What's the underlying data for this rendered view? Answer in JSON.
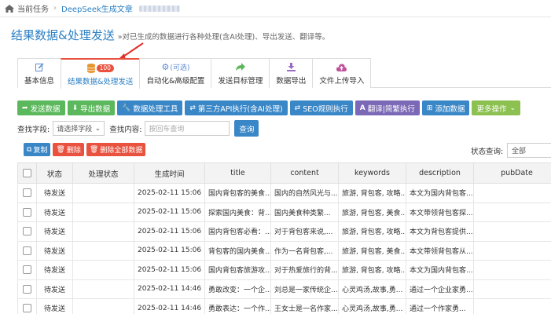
{
  "breadcrumb": {
    "home": "当前任务",
    "current": "DeepSeek生成文章"
  },
  "header": {
    "title": "结果数据&处理发送",
    "subtitle": "»对已生成的数据进行各种处理(含AI处理)、导出发送、翻译等。"
  },
  "tabs": [
    {
      "label": "基本信息",
      "icon": "edit-icon",
      "extra": ""
    },
    {
      "label": "结果数据&处理发送",
      "icon": "database-icon",
      "extra": "100"
    },
    {
      "label": "自动化&高级配置",
      "icon": "gears-icon",
      "extra": "(可选)"
    },
    {
      "label": "发送目标管理",
      "icon": "share-icon",
      "extra": ""
    },
    {
      "label": "数据导出",
      "icon": "download-icon",
      "extra": ""
    },
    {
      "label": "文件上传导入",
      "icon": "cloud-upload-icon",
      "extra": ""
    }
  ],
  "toolbar": [
    {
      "label": "发送数据",
      "color": "#5cb85c",
      "icon": "send-icon"
    },
    {
      "label": "导出数据",
      "color": "#5cb85c",
      "icon": "download-icon"
    },
    {
      "label": "数据处理工具",
      "color": "#3a87c8",
      "icon": "wrench-icon"
    },
    {
      "label": "第三方API执行(含AI处理)",
      "color": "#3a87c8",
      "icon": "exchange-icon"
    },
    {
      "label": "SEO规则执行",
      "color": "#3a87c8",
      "icon": "exchange-icon"
    },
    {
      "label": "翻译|简繁执行",
      "color": "#7b68b6",
      "icon": "font-icon"
    },
    {
      "label": "添加数据",
      "color": "#3a87c8",
      "icon": "plus-icon"
    },
    {
      "label": "更多操作",
      "color": "#8cc152",
      "icon": "chevron-down-icon"
    }
  ],
  "filter": {
    "field_label": "查找字段:",
    "field_placeholder": "请选择字段",
    "content_label": "查找内容:",
    "content_placeholder": "按回车查询",
    "query_label": "查询"
  },
  "actions": {
    "copy": "复制",
    "delete": "删除",
    "delete_all": "删除全部数据"
  },
  "status_query": {
    "label": "状态查询:",
    "value": "全部"
  },
  "table": {
    "columns": [
      "状态",
      "处理状态",
      "生成时间",
      "title",
      "content",
      "keywords",
      "description",
      "pubDate"
    ],
    "rows": [
      [
        "待发送",
        "",
        "2025-02-11 15:06",
        "国内背包客的美食...",
        "国内的自然风光与...",
        "旅游, 背包客, 攻略...",
        "本文为国内背包客...",
        ""
      ],
      [
        "待发送",
        "",
        "2025-02-11 15:06",
        "探索国内美食：背...",
        "国内美食种类繁...",
        "旅游, 背包客, 美食...",
        "本文带领背包客探...",
        ""
      ],
      [
        "待发送",
        "",
        "2025-02-11 15:06",
        "国内背包客必看：...",
        "对于背包客来说,...",
        "旅游, 背包客, 攻略...",
        "本文为背包客提供...",
        ""
      ],
      [
        "待发送",
        "",
        "2025-02-11 15:06",
        "背包客的国内美食...",
        "作为一名背包客,...",
        "旅游, 背包客, 美食...",
        "本文带领背包客从...",
        ""
      ],
      [
        "待发送",
        "",
        "2025-02-11 15:06",
        "国内背包客旅游攻...",
        "对于热爱旅行的背...",
        "旅游, 背包客, 攻略...",
        "本文为国内背包客...",
        ""
      ],
      [
        "待发送",
        "",
        "2025-02-11 14:46",
        "勇敢改变：一个企...",
        "刘总是一家传统企...",
        "心灵鸡汤,故事,勇...",
        "通过一个企业家勇...",
        ""
      ],
      [
        "待发送",
        "",
        "2025-02-11 14:46",
        "勇敢表达：一个作...",
        "王女士是一名作家...",
        "心灵鸡汤,故事,勇...",
        "通过一个作家勇...",
        ""
      ]
    ]
  },
  "colors": {
    "accent": "#2b7fc3",
    "danger": "#e8523f",
    "success": "#5cb85c"
  }
}
